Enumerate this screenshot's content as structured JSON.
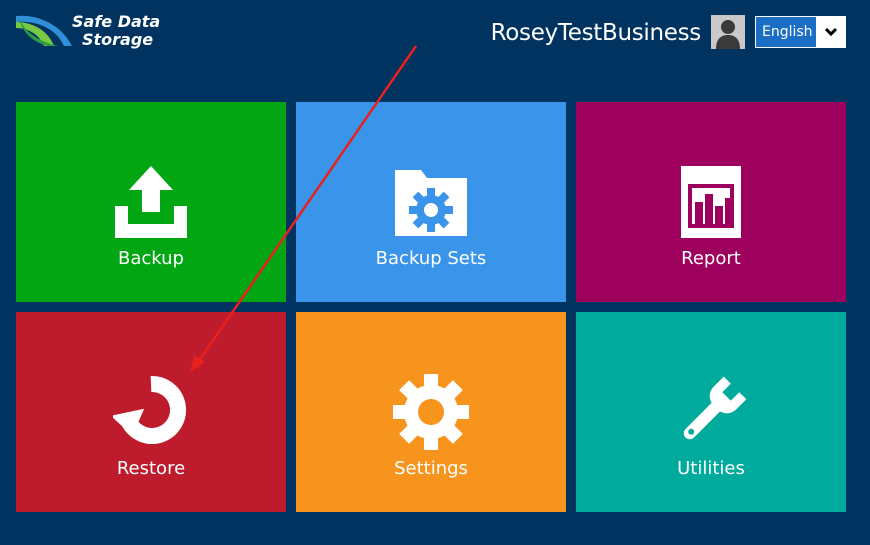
{
  "header": {
    "logo": {
      "line1": "Safe Data",
      "line2": "Storage"
    },
    "username": "RoseyTestBusiness",
    "avatar_icon": "user-silhouette-icon",
    "language": {
      "selected": "English",
      "toggle_icon": "chevron-down-icon"
    }
  },
  "tiles": [
    {
      "label": "Backup",
      "icon": "upload-tray-icon",
      "color": "#02a612"
    },
    {
      "label": "Backup Sets",
      "icon": "folder-gear-icon",
      "color": "#3a95ea"
    },
    {
      "label": "Report",
      "icon": "bar-chart-icon",
      "color": "#9e005d"
    },
    {
      "label": "Restore",
      "icon": "restore-arrow-icon",
      "color": "#be1c2d"
    },
    {
      "label": "Settings",
      "icon": "gear-icon",
      "color": "#f7941d"
    },
    {
      "label": "Utilities",
      "icon": "wrench-icon",
      "color": "#00aa9d"
    }
  ],
  "colors": {
    "background": "#00335f",
    "annotation_arrow": "#e8201f"
  }
}
